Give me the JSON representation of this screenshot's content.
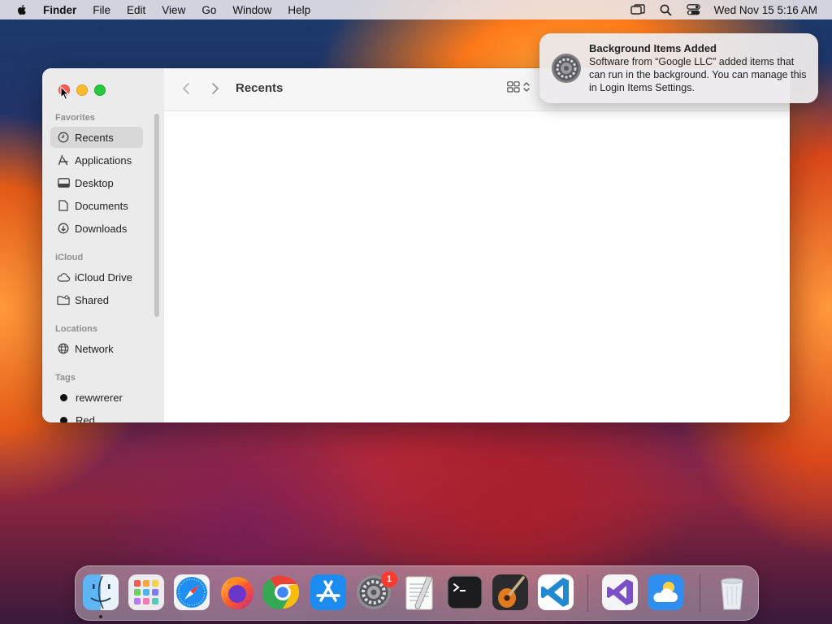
{
  "menubar": {
    "app_name": "Finder",
    "items": [
      "File",
      "Edit",
      "View",
      "Go",
      "Window",
      "Help"
    ],
    "clock": "Wed Nov 15  5:16 AM",
    "status_icons": [
      "screen-mirroring-icon",
      "spotlight-search-icon",
      "control-center-icon"
    ]
  },
  "finder": {
    "title": "Recents",
    "sidebar": {
      "favorites_header": "Favorites",
      "favorites": [
        {
          "label": "Recents",
          "icon": "clock-icon",
          "selected": true
        },
        {
          "label": "Applications",
          "icon": "applications-icon"
        },
        {
          "label": "Desktop",
          "icon": "desktop-icon"
        },
        {
          "label": "Documents",
          "icon": "document-icon"
        },
        {
          "label": "Downloads",
          "icon": "download-icon"
        }
      ],
      "icloud_header": "iCloud",
      "icloud": [
        {
          "label": "iCloud Drive",
          "icon": "cloud-icon"
        },
        {
          "label": "Shared",
          "icon": "shared-folder-icon"
        }
      ],
      "locations_header": "Locations",
      "locations": [
        {
          "label": "Network",
          "icon": "globe-icon"
        }
      ],
      "tags_header": "Tags",
      "tags": [
        {
          "label": "rewwrerer",
          "color": "#111111"
        },
        {
          "label": "Red",
          "color": "#111111"
        }
      ]
    }
  },
  "notification": {
    "title": "Background Items Added",
    "body": "Software from “Google LLC” added items that can run in the background. You can manage this in Login Items Settings.",
    "icon": "system-settings-icon"
  },
  "dock": {
    "apps": [
      "Finder",
      "Launchpad",
      "Safari",
      "Firefox",
      "Google Chrome",
      "App Store",
      "System Settings",
      "TextEdit",
      "Terminal",
      "GarageBand",
      "Visual Studio Code",
      "Visual Studio",
      "Weather",
      "Trash"
    ],
    "system_settings_badge": "1"
  }
}
